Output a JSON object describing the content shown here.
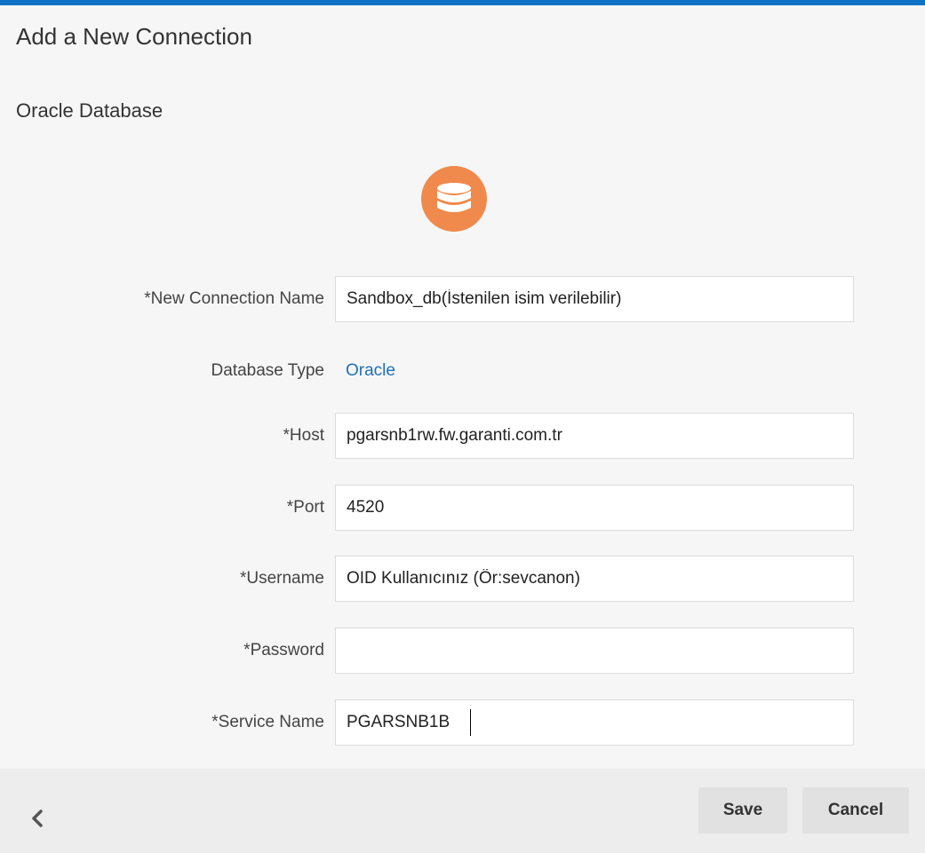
{
  "dialog": {
    "title": "Add a New Connection",
    "subtitle": "Oracle Database",
    "icon": "database-icon",
    "accent_color": "#0c72c5",
    "icon_color": "#ef8a4c"
  },
  "form": {
    "connection_name": {
      "label": "*New Connection Name",
      "value": "Sandbox_db(İstenilen isim verilebilir)"
    },
    "database_type": {
      "label": "Database Type",
      "value": "Oracle"
    },
    "host": {
      "label": "*Host",
      "value": "pgarsnb1rw.fw.garanti.com.tr"
    },
    "port": {
      "label": "*Port",
      "value": "4520"
    },
    "username": {
      "label": "*Username",
      "value": "OID Kullanıcınız (Ör:sevcanon)"
    },
    "password": {
      "label": "*Password",
      "value": ""
    },
    "service_name": {
      "label": "*Service Name",
      "value": "PGARSNB1B"
    }
  },
  "footer": {
    "back_icon": "chevron-left-icon",
    "save_label": "Save",
    "cancel_label": "Cancel"
  }
}
